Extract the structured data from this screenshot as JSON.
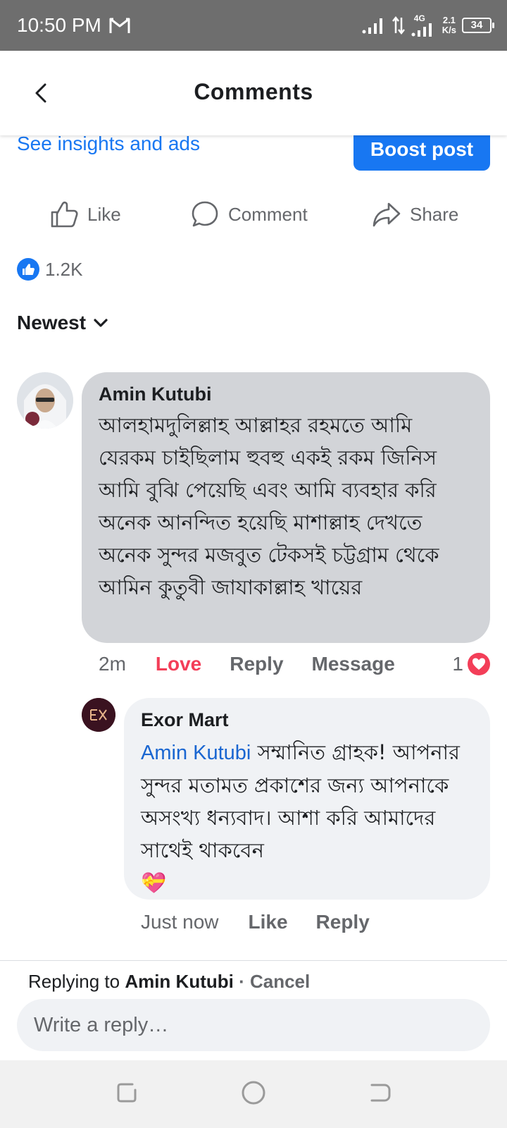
{
  "status_bar": {
    "time": "10:50 PM",
    "network_type": "4G",
    "speed_value": "2.1",
    "speed_unit": "K/s",
    "battery": "34",
    "icons": [
      "gmail-icon",
      "signal-icon",
      "data-arrows-icon",
      "battery-icon"
    ]
  },
  "header": {
    "title": "Comments",
    "back_icon": "back-chevron-icon"
  },
  "post_bar": {
    "insights_label": "See insights and ads",
    "boost_label": "Boost post"
  },
  "actions": [
    {
      "label": "Like",
      "icon": "thumbs-up-icon"
    },
    {
      "label": "Comment",
      "icon": "comment-bubble-icon"
    },
    {
      "label": "Share",
      "icon": "share-arrow-icon"
    }
  ],
  "reactions": {
    "count": "1.2K",
    "icon": "like-reaction-icon"
  },
  "sort": {
    "label": "Newest",
    "icon": "chevron-down-icon"
  },
  "comments": [
    {
      "author": "Amin Kutubi",
      "text": "আলহামদুলিল্লাহ আল্লাহর রহমতে আমি যেরকম চাইছিলাম হুবহু একই রকম জিনিস আমি বুঝি পেয়েছি এবং আমি ব্যবহার করি অনেক  আনন্দিত হয়েছি মাশাল্লাহ দেখতে অনেক সুন্দর মজবুত টেকসই চট্টগ্রাম থেকে আমিন কুতুবী জাযাকাল্লাহ খায়ের",
      "time": "2m",
      "reaction_label": "Love",
      "reply_label": "Reply",
      "message_label": "Message",
      "reaction_count": "1",
      "bubble_color": "#d2d4d8",
      "reaction_color": "#f33e58"
    }
  ],
  "replies": [
    {
      "author": "Exor Mart",
      "mention": "Amin Kutubi",
      "text": " সম্মানিত গ্রাহক! আপনার সুন্দর মতামত প্রকাশের জন্য আপনাকে অসংখ্য ধন্যবাদ। আশা করি আমাদের সাথেই থাকবেন",
      "emoji": "💝",
      "time": "Just now",
      "like_label": "Like",
      "reply_label": "Reply",
      "bubble_color": "#f0f2f5"
    }
  ],
  "reply_bar": {
    "prefix": "Replying to",
    "target": "Amin Kutubi",
    "separator": " · ",
    "cancel_label": "Cancel",
    "placeholder": "Write a reply…"
  },
  "nav_bar": {
    "icons": [
      "recent-apps-icon",
      "home-icon",
      "back-icon"
    ]
  },
  "colors": {
    "accent": "#1877f2",
    "love": "#f33e58",
    "status_bar": "#6e6e6e",
    "secondary_text": "#65676b"
  }
}
